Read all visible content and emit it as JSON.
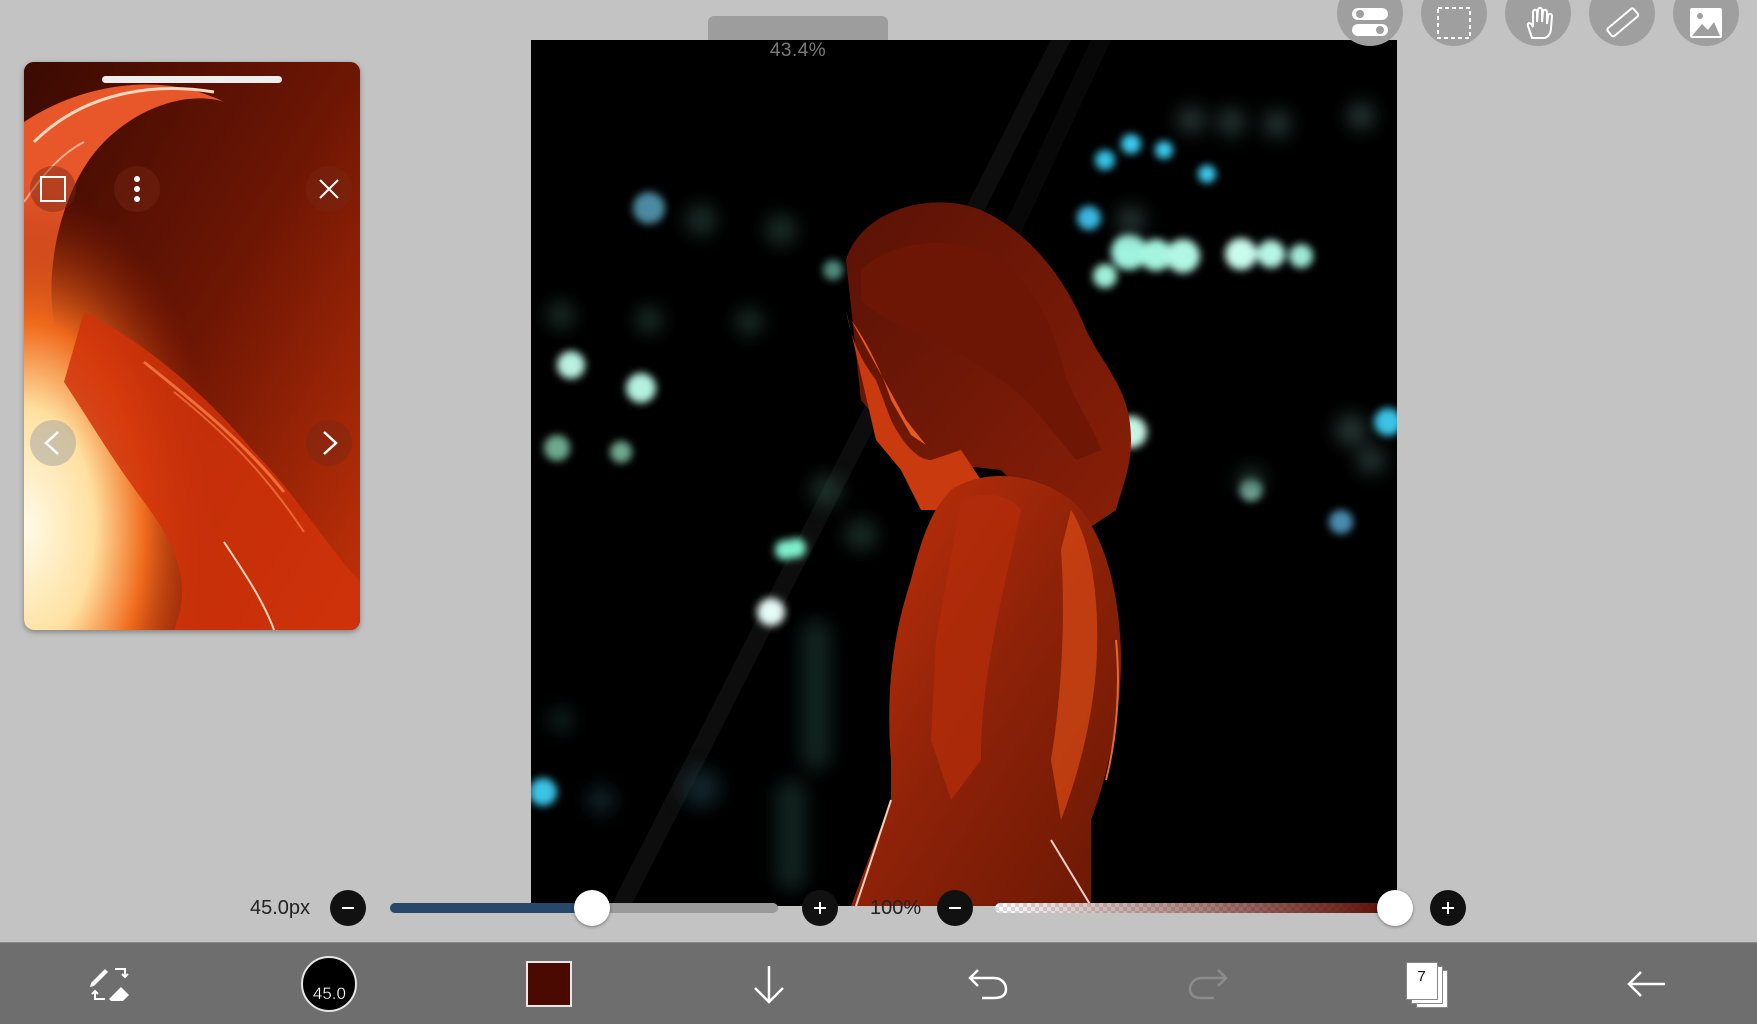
{
  "canvas": {
    "zoom_label": "43.4%"
  },
  "top_tools": [
    {
      "name": "toggle-icon"
    },
    {
      "name": "selection-icon"
    },
    {
      "name": "hand-icon"
    },
    {
      "name": "ruler-icon"
    },
    {
      "name": "material-image-icon"
    }
  ],
  "reference_window": {
    "buttons": [
      "frame-icon",
      "more-icon",
      "close-icon",
      "previous-icon",
      "next-icon"
    ]
  },
  "brush_size": {
    "label": "45.0px",
    "value_fraction": 0.52
  },
  "opacity": {
    "label": "100%",
    "value_fraction": 1.0
  },
  "bottom_bar": {
    "brush_size_label": "45.0",
    "current_color": "#4a0a02",
    "layer_count": "7"
  },
  "colors": {
    "background": "#c3c3c3",
    "toolbar": "#6e6e6e",
    "slider_fill": "#274868"
  }
}
